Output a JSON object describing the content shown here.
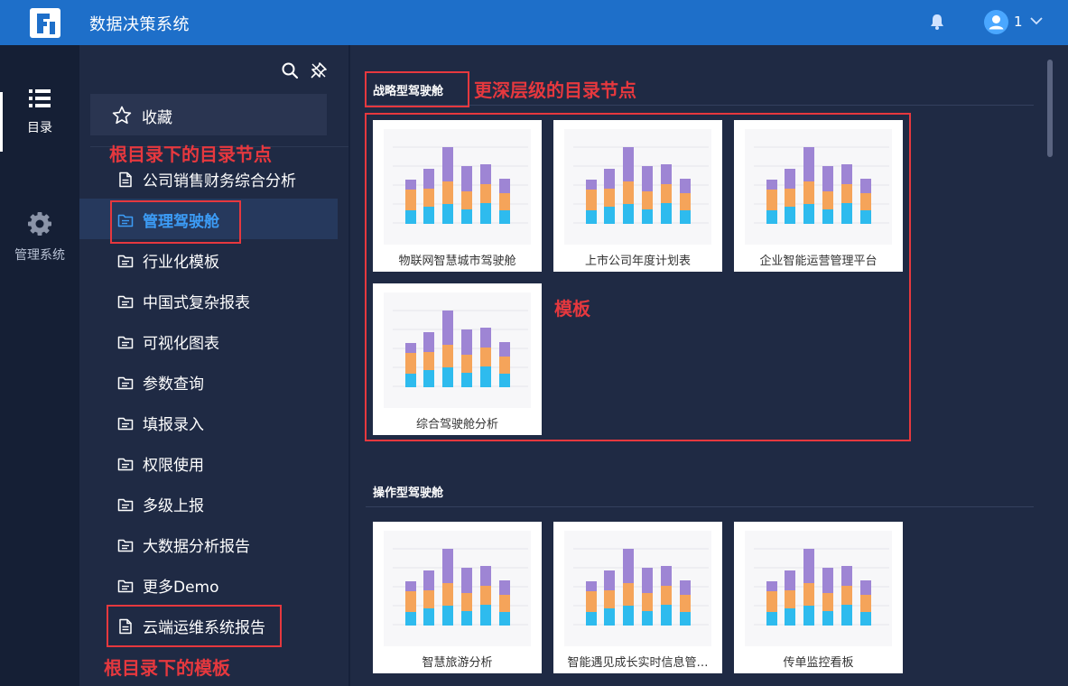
{
  "header": {
    "app_title": "数据决策系统",
    "user_name": "1",
    "accent": "#1e6fc9"
  },
  "rail": {
    "items": [
      {
        "label": "目录",
        "icon": "list-icon",
        "active": true
      },
      {
        "label": "管理系统",
        "icon": "gear-icon",
        "active": false
      }
    ]
  },
  "tree": {
    "favorites_label": "收藏",
    "nodes": [
      {
        "label": "公司销售财务综合分析",
        "type": "file"
      },
      {
        "label": "管理驾驶舱",
        "type": "folder",
        "active": true
      },
      {
        "label": "行业化模板",
        "type": "folder"
      },
      {
        "label": "中国式复杂报表",
        "type": "folder"
      },
      {
        "label": "可视化图表",
        "type": "folder"
      },
      {
        "label": "参数查询",
        "type": "folder"
      },
      {
        "label": "填报录入",
        "type": "folder"
      },
      {
        "label": "权限使用",
        "type": "folder"
      },
      {
        "label": "多级上报",
        "type": "folder"
      },
      {
        "label": "大数据分析报告",
        "type": "folder"
      },
      {
        "label": "更多Demo",
        "type": "folder"
      },
      {
        "label": "云端运维系统报告",
        "type": "file"
      }
    ]
  },
  "main": {
    "sections": [
      {
        "title": "战略型驾驶舱",
        "cards": [
          "物联网智慧城市驾驶舱",
          "上市公司年度计划表",
          "企业智能运营管理平台",
          "综合驾驶舱分析"
        ]
      },
      {
        "title": "操作型驾驶舱",
        "cards": [
          "智慧旅游分析",
          "智能遇见成长实时信息管…",
          "传单监控看板"
        ]
      }
    ]
  },
  "annotations": {
    "deeper_node": "更深层级的目录节点",
    "root_node": "根目录下的目录节点",
    "template": "模板",
    "root_template": "根目录下的模板",
    "color": "#e6383e"
  },
  "thumbnail_colors": {
    "top": "#9e85d4",
    "middle": "#f5a45a",
    "bottom": "#2ebbee"
  }
}
